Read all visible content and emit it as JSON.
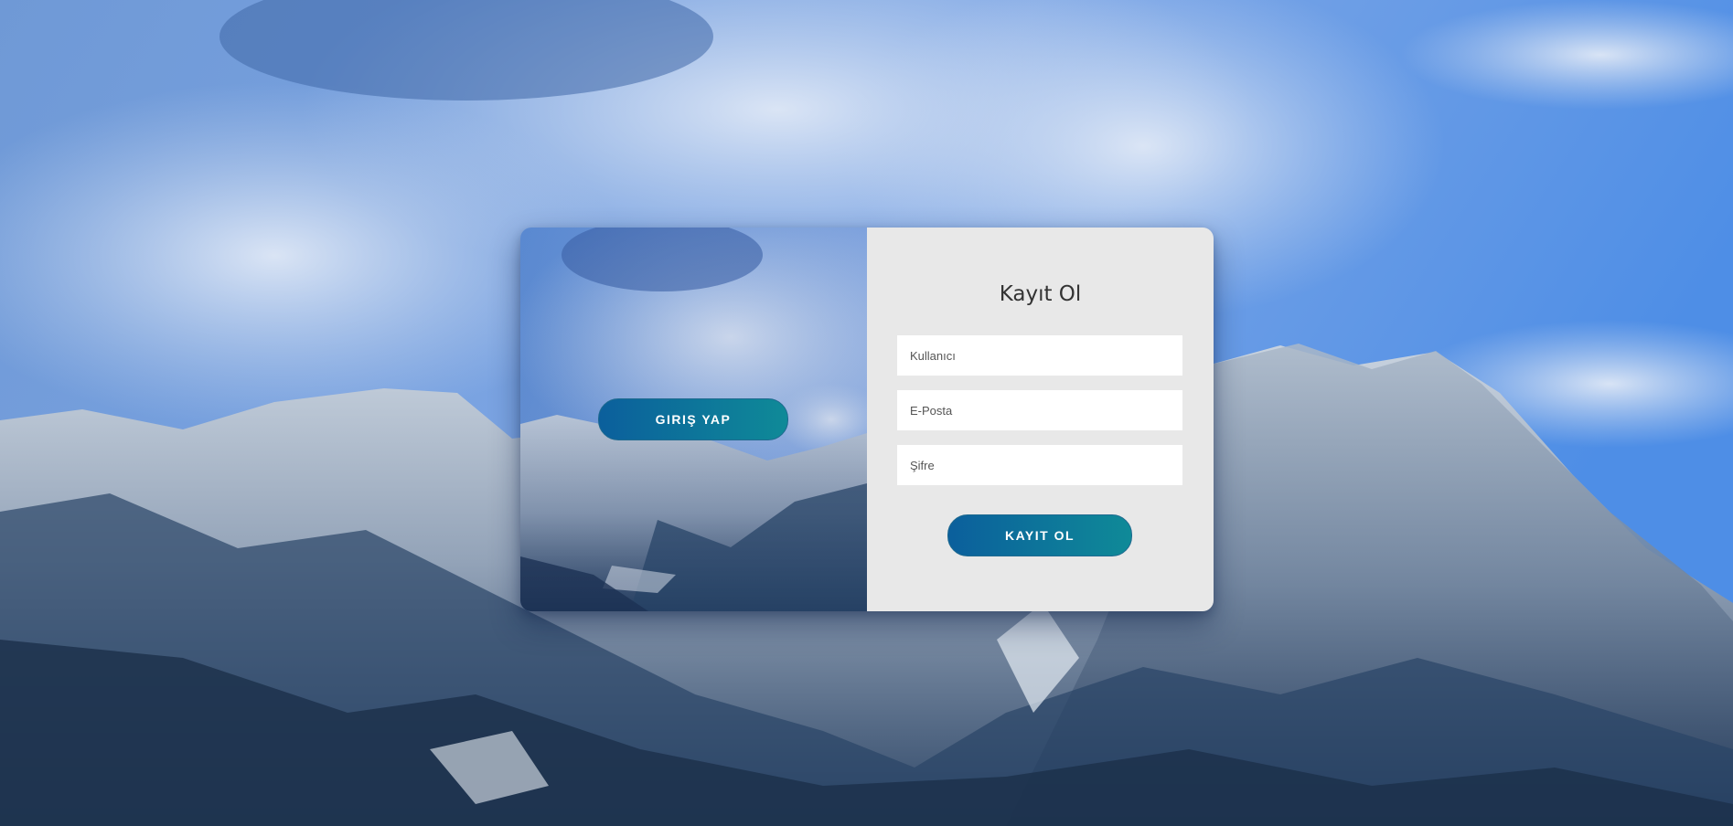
{
  "signin_panel": {
    "button_label": "GIRIŞ YAP"
  },
  "signup_form": {
    "title": "Kayıt Ol",
    "username_placeholder": "Kullanıcı",
    "email_placeholder": "E-Posta",
    "password_placeholder": "Şifre",
    "submit_label": "KAYIT OL"
  },
  "colors": {
    "button_gradient_start": "#0b5f9c",
    "button_gradient_end": "#0f8a98",
    "form_background": "#e8e8e8",
    "sky": "#5a94e0"
  }
}
